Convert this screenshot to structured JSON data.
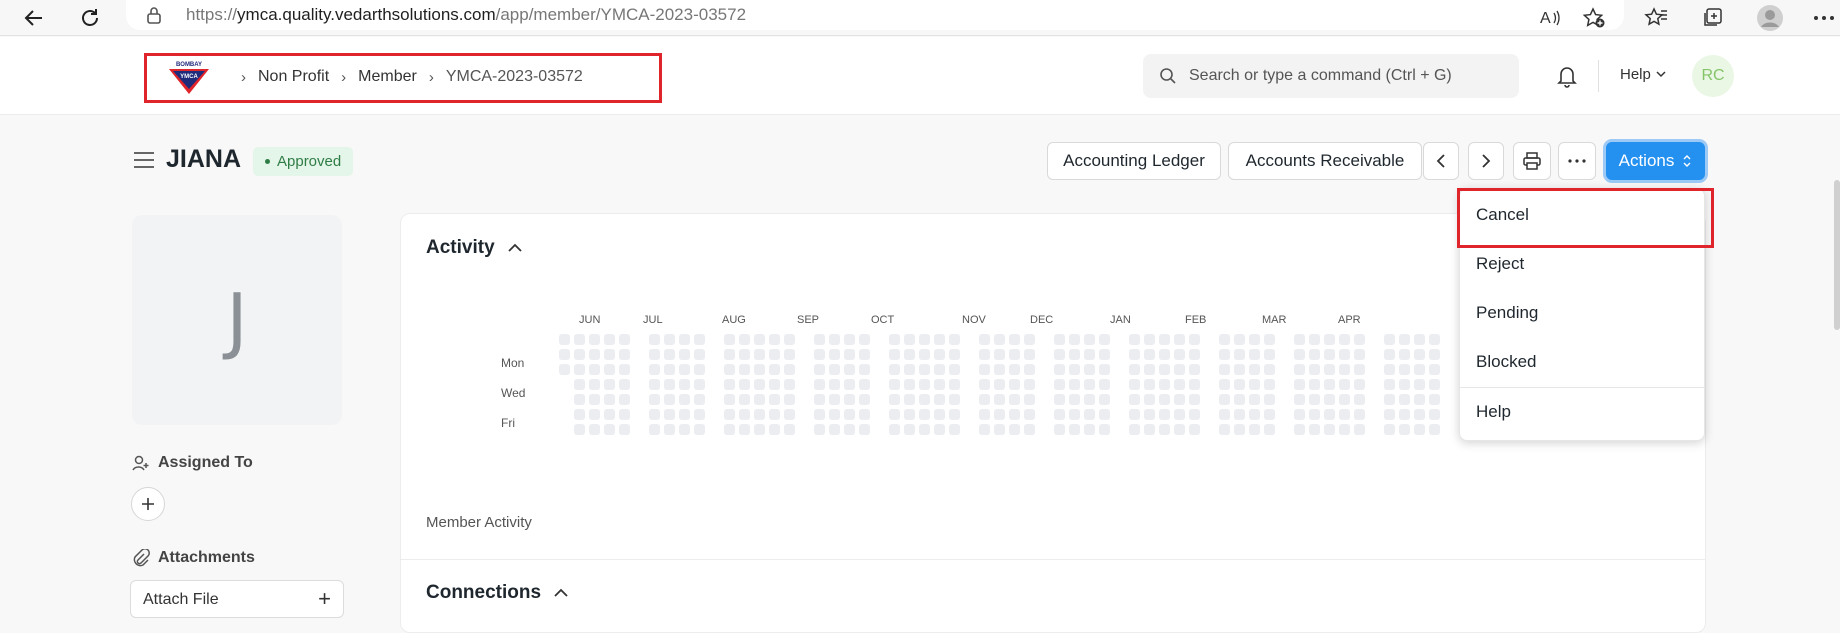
{
  "browser": {
    "url_prefix": "https://",
    "url_host": "ymca.quality.vedarthsolutions.com",
    "url_path": "/app/member/YMCA-2023-03572"
  },
  "header": {
    "logo_text_top": "BOMBAY",
    "logo_text_bottom": "YMCA",
    "breadcrumbs": [
      "Non Profit",
      "Member",
      "YMCA-2023-03572"
    ],
    "search_placeholder": "Search or type a command (Ctrl + G)",
    "help_label": "Help",
    "avatar_initials": "RC",
    "colors": {
      "avatar_bg": "#eaf7e5",
      "avatar_fg": "#86c46a",
      "highlight": "#e0242c"
    }
  },
  "page": {
    "title": "JIANA",
    "status": "Approved",
    "status_color": "#2f7d46",
    "buttons": {
      "accounting_ledger": "Accounting Ledger",
      "accounts_receivable": "Accounts Receivable",
      "actions": "Actions"
    }
  },
  "sidebar": {
    "avatar_letter": "J",
    "assigned_to_label": "Assigned To",
    "attachments_label": "Attachments",
    "attach_file_label": "Attach File"
  },
  "activity": {
    "title": "Activity",
    "months": [
      "JUN",
      "JUL",
      "AUG",
      "SEP",
      "OCT",
      "NOV",
      "DEC",
      "JAN",
      "FEB",
      "MAR",
      "APR"
    ],
    "days": [
      "Mon",
      "Wed",
      "Fri"
    ],
    "footer": "Member Activity",
    "cell_color": "#ebedf0"
  },
  "connections": {
    "title": "Connections"
  },
  "actions_menu": {
    "items": [
      "Cancel",
      "Reject",
      "Pending",
      "Blocked"
    ],
    "help": "Help"
  }
}
